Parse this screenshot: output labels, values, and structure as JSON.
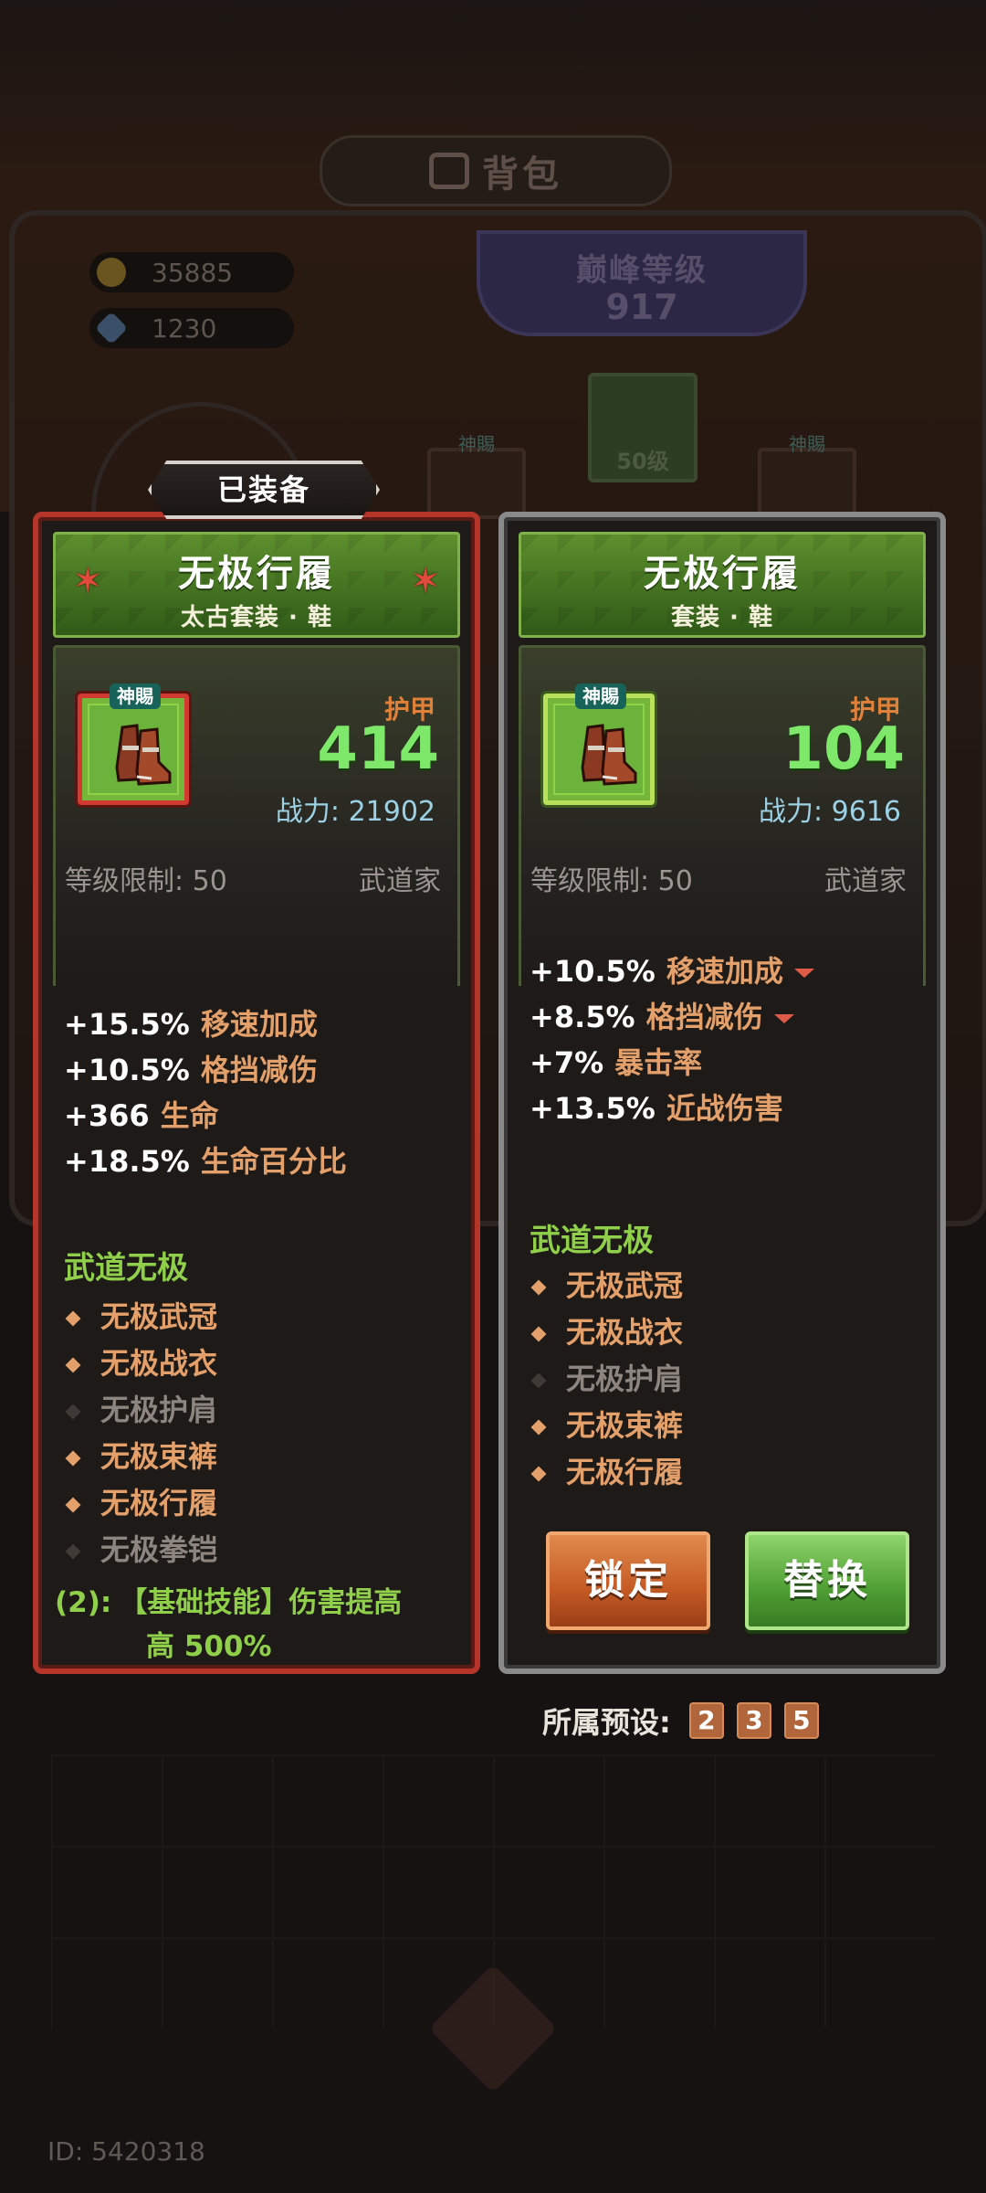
{
  "background": {
    "bag_title": "背包",
    "gold": "35885",
    "gems": "1230",
    "peak_label": "巅峰等级",
    "peak_value": "917",
    "slot_center_level": "50级",
    "slot_tag": "神賜",
    "id_label": "ID: 5420318"
  },
  "equipped_tag": "已装备",
  "left_card": {
    "name": "无极行履",
    "subtitle": "太古套装 · 鞋",
    "divine_tag": "神賜",
    "stat_label": "护甲",
    "stat_value": "414",
    "power": "战力: 21902",
    "level_req": "等级限制: 50",
    "class": "武道家",
    "attributes": [
      {
        "value": "+15.5%",
        "name": "移速加成"
      },
      {
        "value": "+10.5%",
        "name": "格挡减伤"
      },
      {
        "value": "+366",
        "name": "生命"
      },
      {
        "value": "+18.5%",
        "name": "生命百分比"
      }
    ],
    "set_title": "武道无极",
    "set_items": [
      {
        "name": "无极武冠",
        "owned": true
      },
      {
        "name": "无极战衣",
        "owned": true
      },
      {
        "name": "无极护肩",
        "owned": false
      },
      {
        "name": "无极束裤",
        "owned": true
      },
      {
        "name": "无极行履",
        "owned": true
      },
      {
        "name": "无极拳铠",
        "owned": false
      }
    ],
    "set_bonus_prefix": "(2):",
    "set_bonus_line1": "【基础技能】伤害提高",
    "set_bonus_line2": "高 500%"
  },
  "right_card": {
    "name": "无极行履",
    "subtitle": "套装 · 鞋",
    "divine_tag": "神賜",
    "stat_label": "护甲",
    "stat_value": "104",
    "power": "战力: 9616",
    "level_req": "等级限制: 50",
    "class": "武道家",
    "attributes": [
      {
        "value": "+10.5%",
        "name": "移速加成",
        "lower": true
      },
      {
        "value": "+8.5%",
        "name": "格挡减伤",
        "lower": true
      },
      {
        "value": "+7%",
        "name": "暴击率",
        "lower": false
      },
      {
        "value": "+13.5%",
        "name": "近战伤害",
        "lower": false
      }
    ],
    "set_title": "武道无极",
    "set_items": [
      {
        "name": "无极武冠",
        "owned": true
      },
      {
        "name": "无极战衣",
        "owned": true
      },
      {
        "name": "无极护肩",
        "owned": false
      },
      {
        "name": "无极束裤",
        "owned": true
      },
      {
        "name": "无极行履",
        "owned": true
      }
    ],
    "lock_button": "锁定",
    "replace_button": "替换"
  },
  "preset": {
    "label": "所属预设:",
    "numbers": [
      "2",
      "3",
      "5"
    ]
  },
  "colors": {
    "equipped_border": "#b6352a",
    "compare_border": "#8a8a8a",
    "stat_green": "#7ee86a",
    "attr_orange": "#e3a06a",
    "set_green": "#8fcf4a"
  }
}
